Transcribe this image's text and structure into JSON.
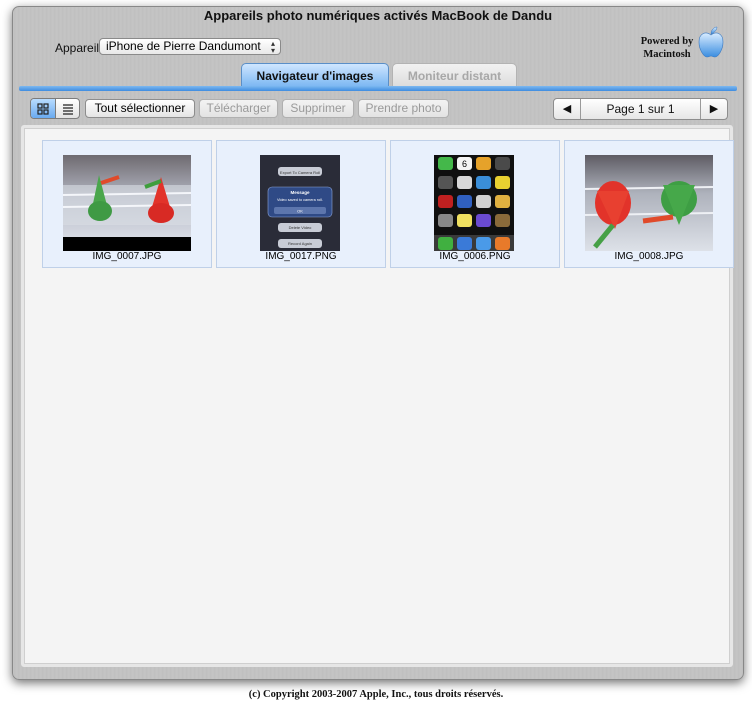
{
  "window": {
    "title": "Appareils photo numériques activés MacBook de Dandu"
  },
  "device": {
    "label": "Appareil",
    "selected": "iPhone de Pierre Dandumont"
  },
  "branding": {
    "line1": "Powered by",
    "line2": "Macintosh",
    "icon": "apple-logo-icon"
  },
  "tabs": [
    {
      "label": "Navigateur d'images",
      "active": true
    },
    {
      "label": "Moniteur distant",
      "active": false
    }
  ],
  "toolbar": {
    "view_icons": [
      "grid-view-icon",
      "list-view-icon"
    ],
    "select_all": "Tout sélectionner",
    "download": "Télécharger",
    "delete": "Supprimer",
    "take_photo": "Prendre photo",
    "page_text": "Page 1 sur 1",
    "prev_icon": "◀",
    "next_icon": "▶"
  },
  "images": [
    {
      "name": "IMG_0007.JPG"
    },
    {
      "name": "IMG_0017.PNG"
    },
    {
      "name": "IMG_0006.PNG"
    },
    {
      "name": "IMG_0008.JPG"
    }
  ],
  "screenshot_text": {
    "export": "Export To Camera Roll",
    "msg_title": "Message",
    "msg_body": "Video saved to camera roll.",
    "ok": "OK",
    "delete": "Delete Video",
    "record": "Record Again",
    "calendar_day": "6"
  },
  "footer": {
    "copyright": "(c) Copyright 2003-2007 Apple, Inc., tous droits réservés."
  },
  "colors": {
    "accent": "#5aa0ea",
    "tab_active": "#8cc1f5",
    "thumb_bg": "#e8f0fc"
  }
}
